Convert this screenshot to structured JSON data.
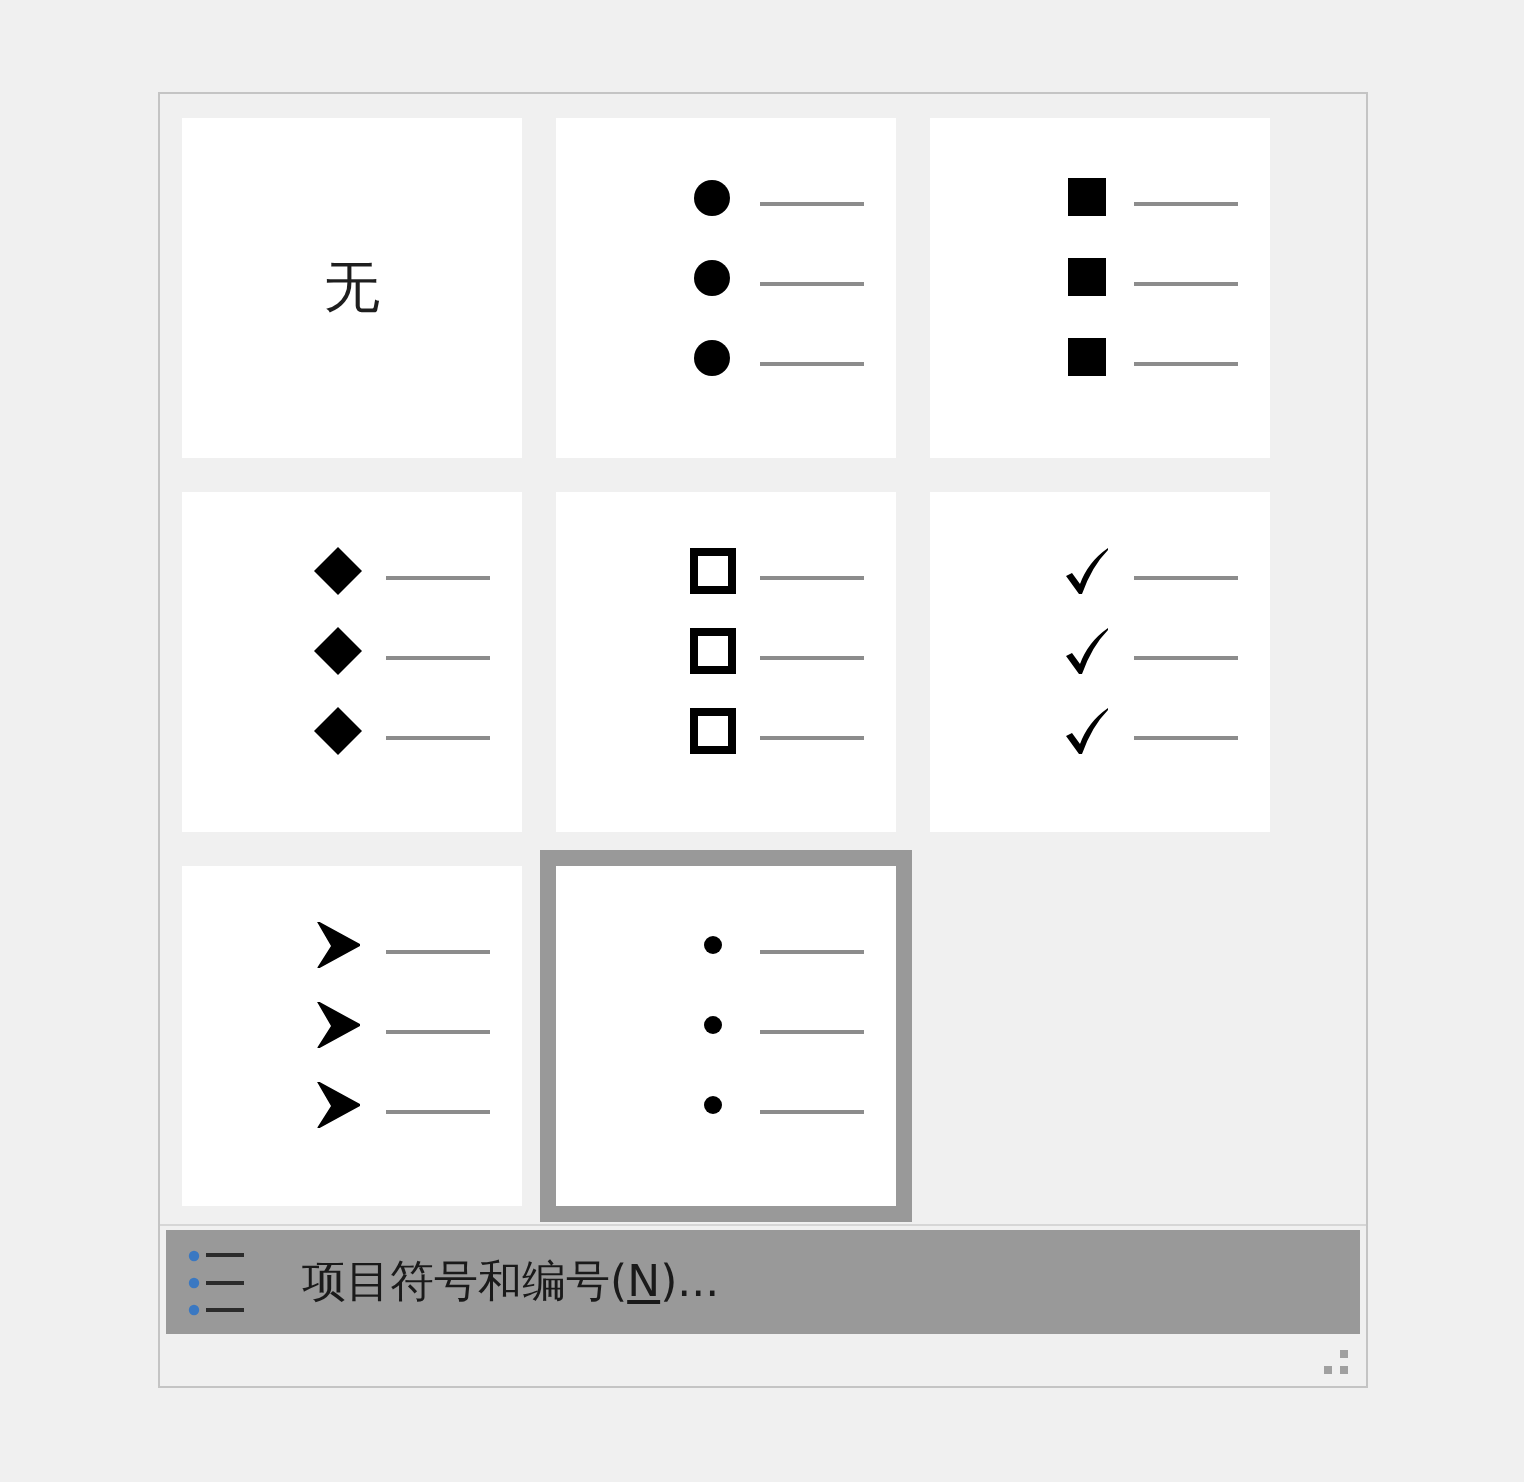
{
  "bullet_library": {
    "options": [
      {
        "kind": "none",
        "label": "无",
        "selected": false
      },
      {
        "kind": "filled-circle",
        "selected": false
      },
      {
        "kind": "filled-square",
        "selected": false
      },
      {
        "kind": "diamond",
        "selected": false
      },
      {
        "kind": "hollow-square",
        "selected": false
      },
      {
        "kind": "check",
        "selected": false
      },
      {
        "kind": "arrowhead",
        "selected": false
      },
      {
        "kind": "dot",
        "selected": true
      }
    ]
  },
  "menu_item": {
    "label_before": "项目符号和编号(",
    "mnemonic": "N",
    "label_after": ")...",
    "highlighted": true
  }
}
